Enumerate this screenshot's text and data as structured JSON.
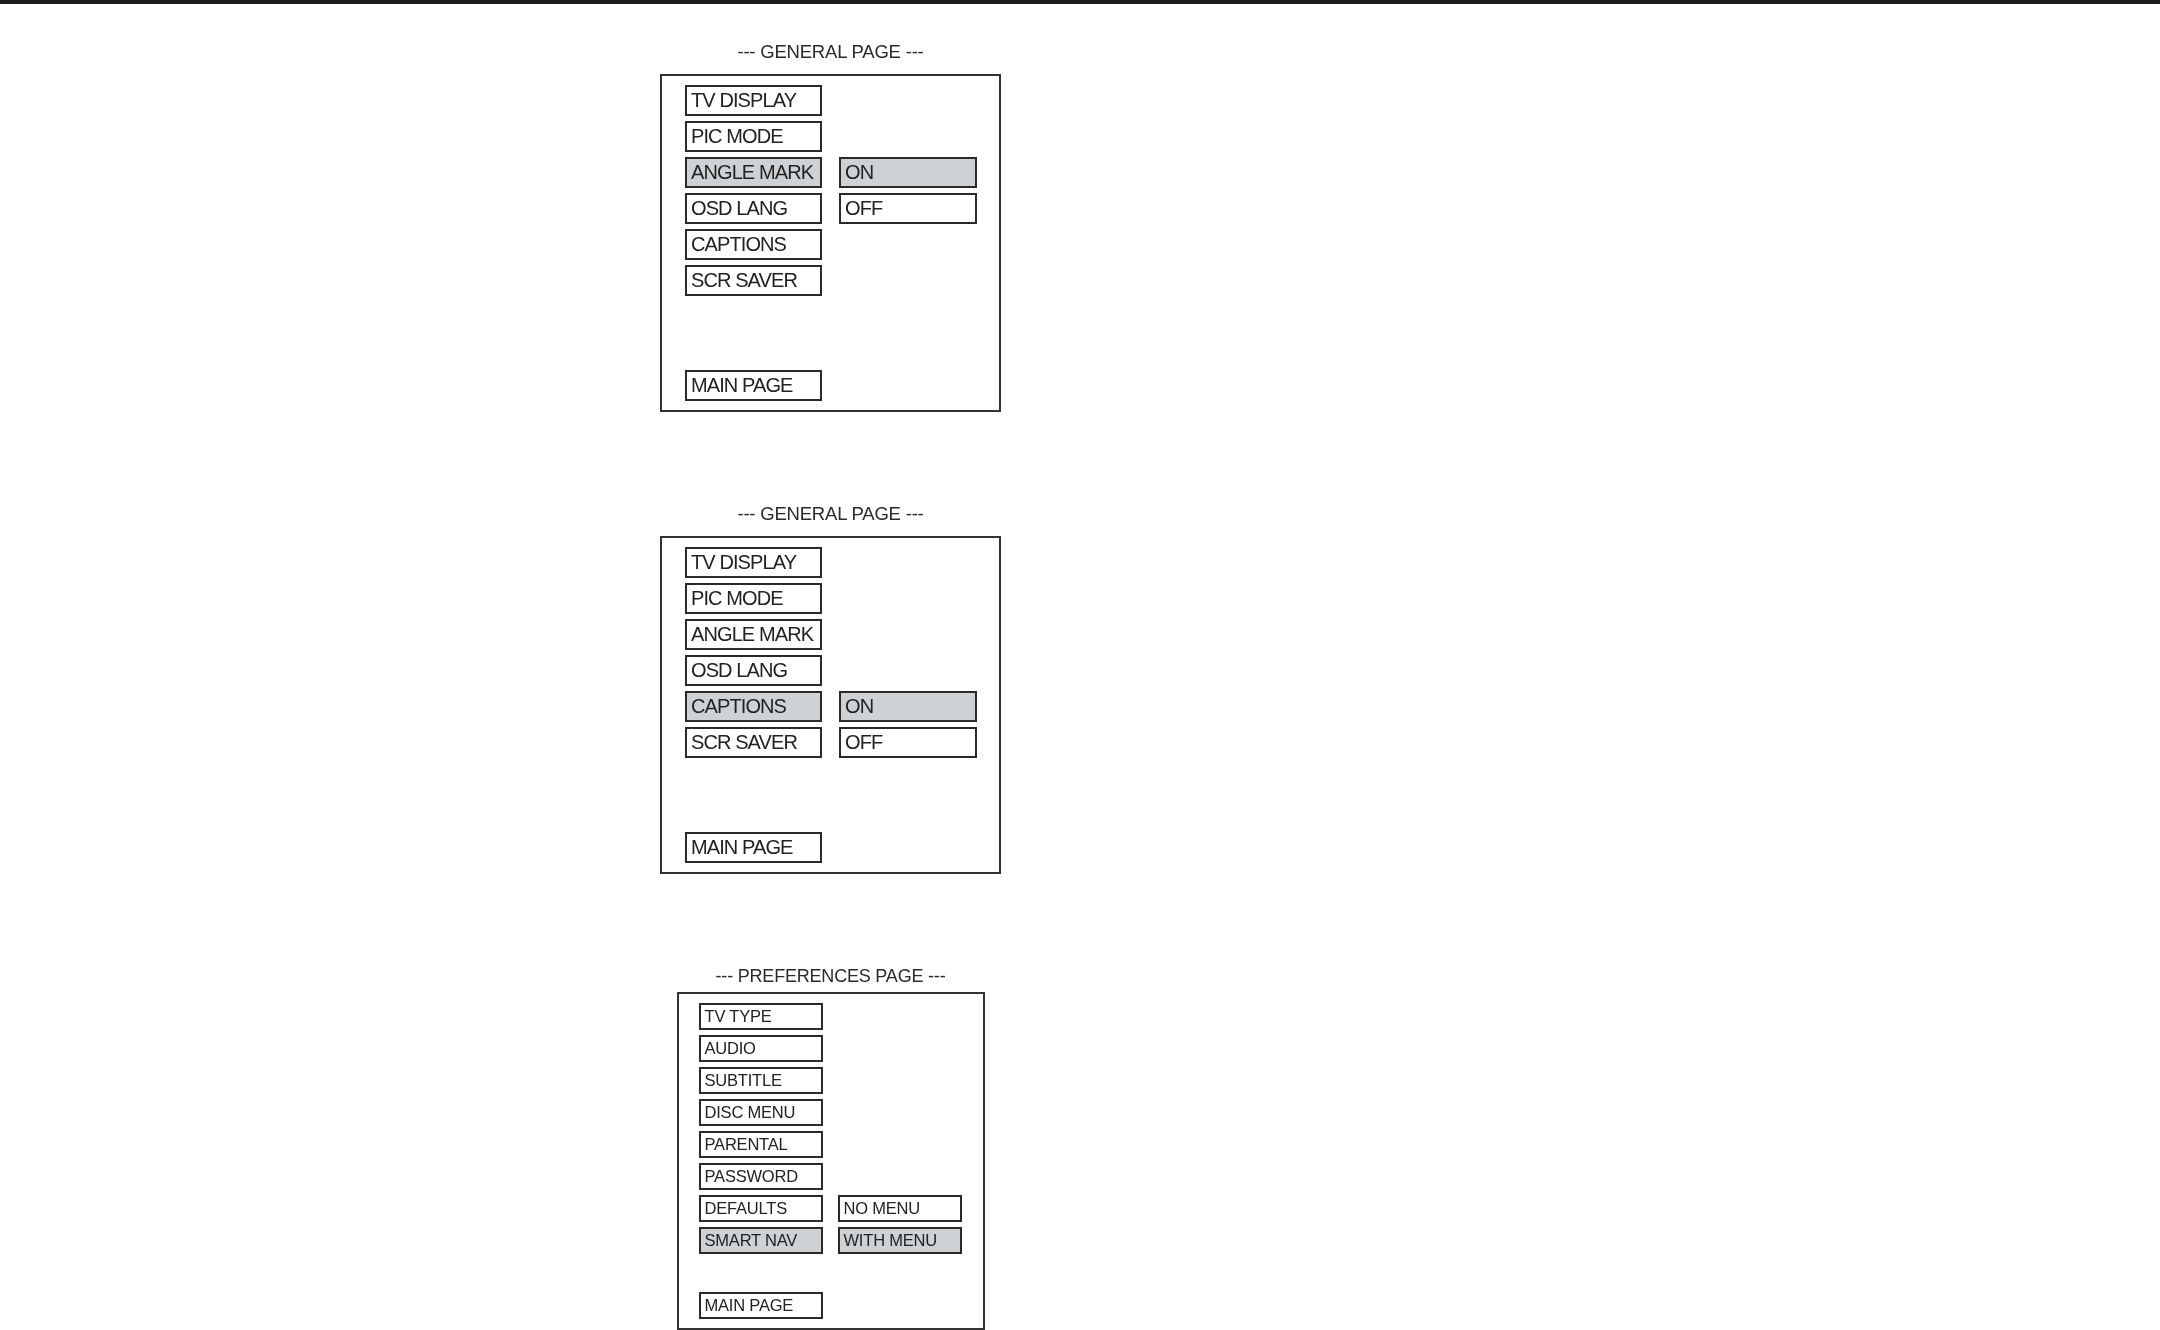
{
  "pages": [
    {
      "title": "--- GENERAL PAGE ---",
      "items": [
        {
          "label": "TV DISPLAY",
          "selected": false
        },
        {
          "label": "PIC MODE",
          "selected": false
        },
        {
          "label": "ANGLE MARK",
          "selected": true
        },
        {
          "label": "OSD LANG",
          "selected": false
        },
        {
          "label": "CAPTIONS",
          "selected": false
        },
        {
          "label": "SCR SAVER",
          "selected": false
        }
      ],
      "options": [
        {
          "label": "ON",
          "selected": true
        },
        {
          "label": "OFF",
          "selected": false
        }
      ],
      "main_page": "MAIN PAGE"
    },
    {
      "title": "--- GENERAL PAGE ---",
      "items": [
        {
          "label": "TV DISPLAY",
          "selected": false
        },
        {
          "label": "PIC MODE",
          "selected": false
        },
        {
          "label": "ANGLE MARK",
          "selected": false
        },
        {
          "label": "OSD LANG",
          "selected": false
        },
        {
          "label": "CAPTIONS",
          "selected": true
        },
        {
          "label": "SCR SAVER",
          "selected": false
        }
      ],
      "options": [
        {
          "label": "ON",
          "selected": true
        },
        {
          "label": "OFF",
          "selected": false
        }
      ],
      "main_page": "MAIN PAGE"
    },
    {
      "title": "--- PREFERENCES PAGE ---",
      "items": [
        {
          "label": "TV TYPE",
          "selected": false
        },
        {
          "label": "AUDIO",
          "selected": false
        },
        {
          "label": "SUBTITLE",
          "selected": false
        },
        {
          "label": "DISC MENU",
          "selected": false
        },
        {
          "label": "PARENTAL",
          "selected": false
        },
        {
          "label": "PASSWORD",
          "selected": false
        },
        {
          "label": "DEFAULTS",
          "selected": false
        },
        {
          "label": "SMART NAV",
          "selected": true
        }
      ],
      "options": [
        {
          "label": "NO MENU",
          "selected": false
        },
        {
          "label": "WITH MENU",
          "selected": true
        }
      ],
      "main_page": "MAIN PAGE"
    }
  ]
}
